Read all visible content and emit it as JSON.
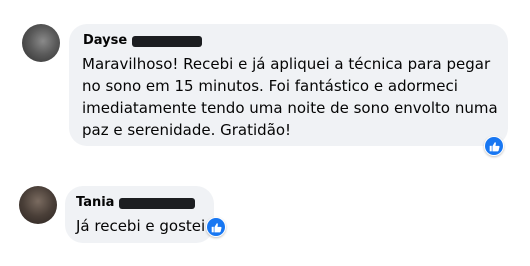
{
  "comments": [
    {
      "author": "Dayse",
      "text_lines": [
        "Maravilhoso! Recebi e já apliquei a técnica para pegar",
        "no sono em 15 minutos. Foi fantástico e adormeci",
        "imediatamente tendo uma noite de sono envolto numa",
        "paz e serenidade. Gratidão!"
      ],
      "reaction_icon": "like-icon"
    },
    {
      "author": "Tania",
      "text_lines": [
        "Já recebi e gostei"
      ],
      "reaction_icon": "like-icon"
    }
  ],
  "colors": {
    "bubble_bg": "#f0f2f5",
    "text": "#050505",
    "like_blue": "#1877f2",
    "redaction": "#1c1e21"
  }
}
